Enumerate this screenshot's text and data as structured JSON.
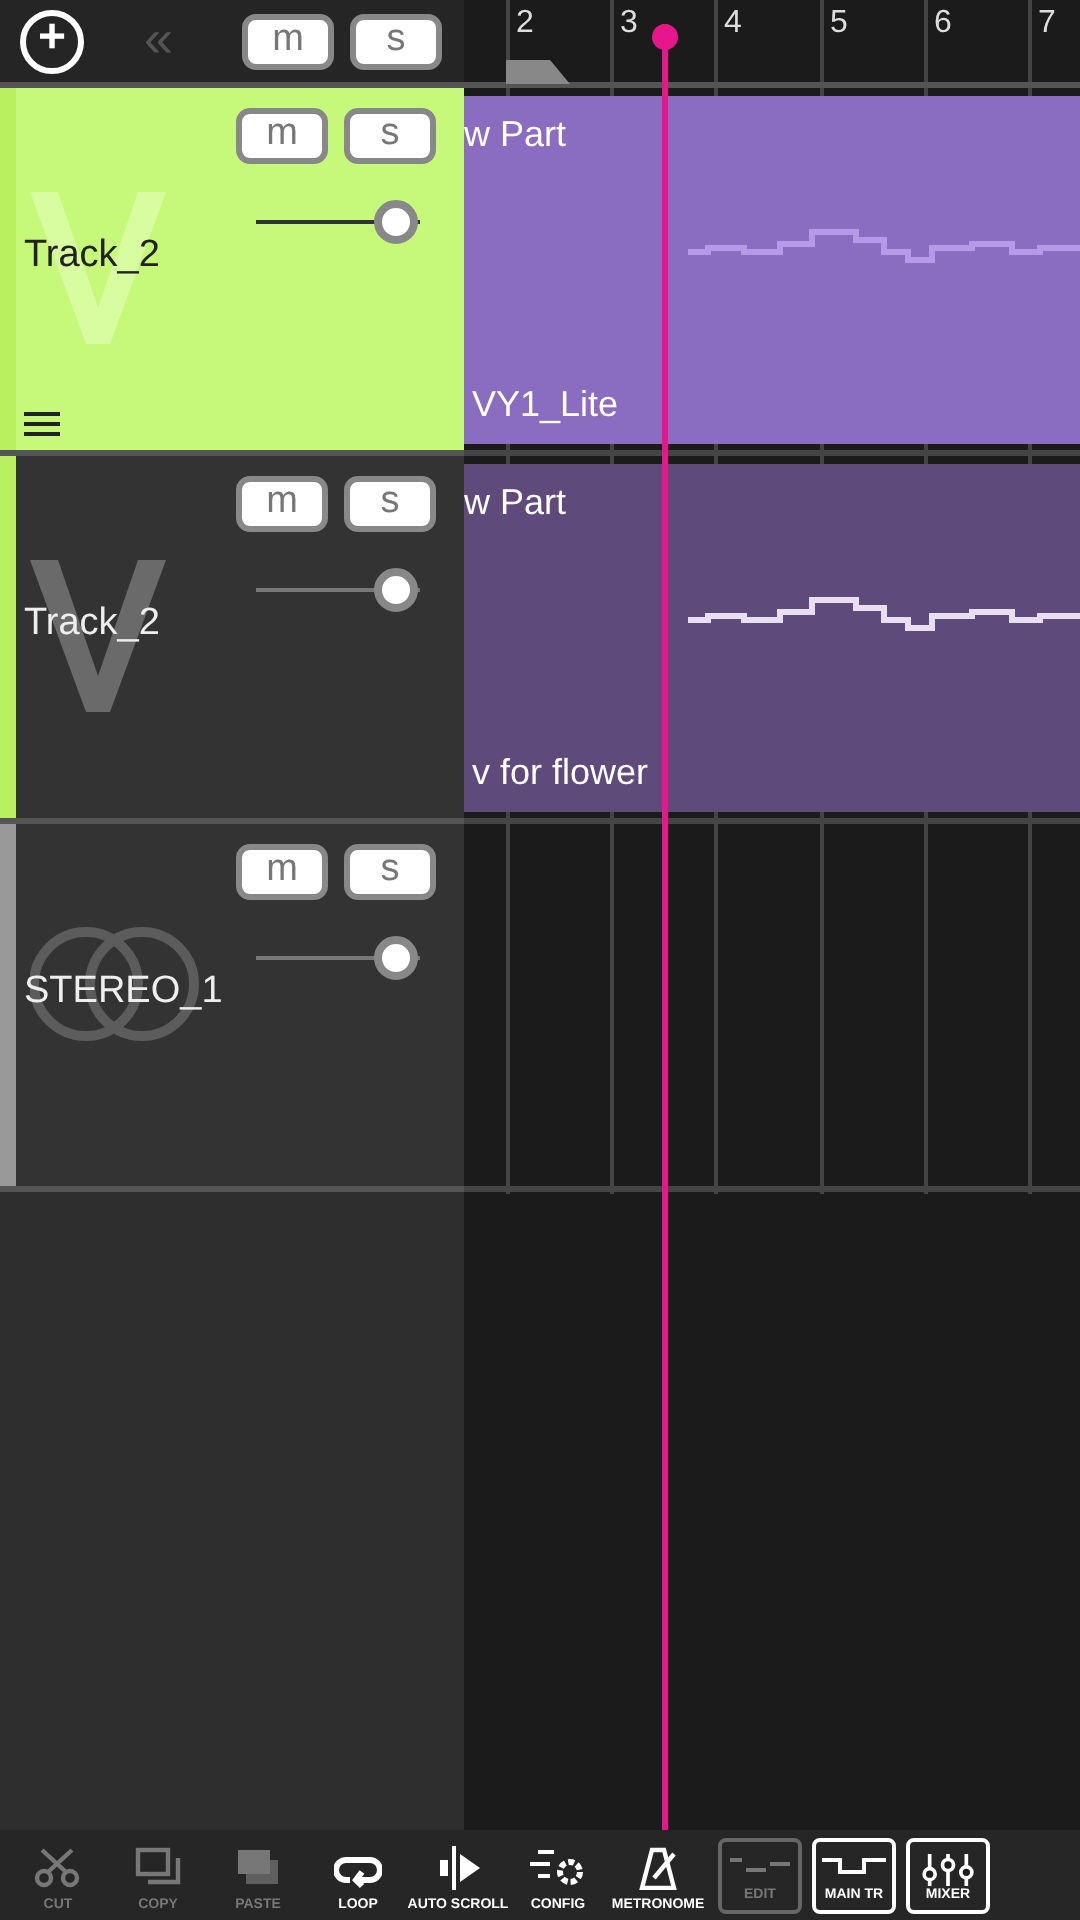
{
  "header": {
    "add_label": "+",
    "collapse_label": "«",
    "mute_label": "m",
    "solo_label": "s",
    "muted": false,
    "solo": false
  },
  "ruler": {
    "bars": [
      "2",
      "3",
      "4",
      "5",
      "6",
      "7"
    ]
  },
  "tracks": [
    {
      "kind": "vocal",
      "name": "Track_2",
      "selected": true,
      "muted": false,
      "solo": false,
      "level": 0.85,
      "mute_label": "m",
      "solo_label": "s",
      "part": {
        "title": "w Part",
        "singer": "VY1_Lite"
      }
    },
    {
      "kind": "vocal",
      "name": "Track_2",
      "selected": false,
      "muted": false,
      "solo": false,
      "level": 0.85,
      "mute_label": "m",
      "solo_label": "s",
      "part": {
        "title": "w Part",
        "singer": "v for flower"
      }
    },
    {
      "kind": "audio",
      "name": "STEREO_1",
      "selected": false,
      "muted": false,
      "solo": false,
      "level": 0.85,
      "mute_label": "m",
      "solo_label": "s"
    }
  ],
  "toolbar": [
    {
      "kind": "tool",
      "label": "CUT",
      "disabled": true
    },
    {
      "kind": "tool",
      "label": "COPY",
      "disabled": true
    },
    {
      "kind": "tool",
      "label": "PASTE",
      "disabled": true
    },
    {
      "kind": "tool",
      "label": "LOOP",
      "disabled": false
    },
    {
      "kind": "tool",
      "label": "AUTO SCROLL",
      "disabled": false
    },
    {
      "kind": "tool",
      "label": "CONFIG",
      "disabled": false
    },
    {
      "kind": "tool",
      "label": "METRONOME",
      "disabled": false
    },
    {
      "kind": "mode",
      "label": "EDIT",
      "disabled": true
    },
    {
      "kind": "mode",
      "label": "MAIN TR",
      "disabled": false
    },
    {
      "kind": "mode",
      "label": "MIXER",
      "disabled": false
    }
  ]
}
